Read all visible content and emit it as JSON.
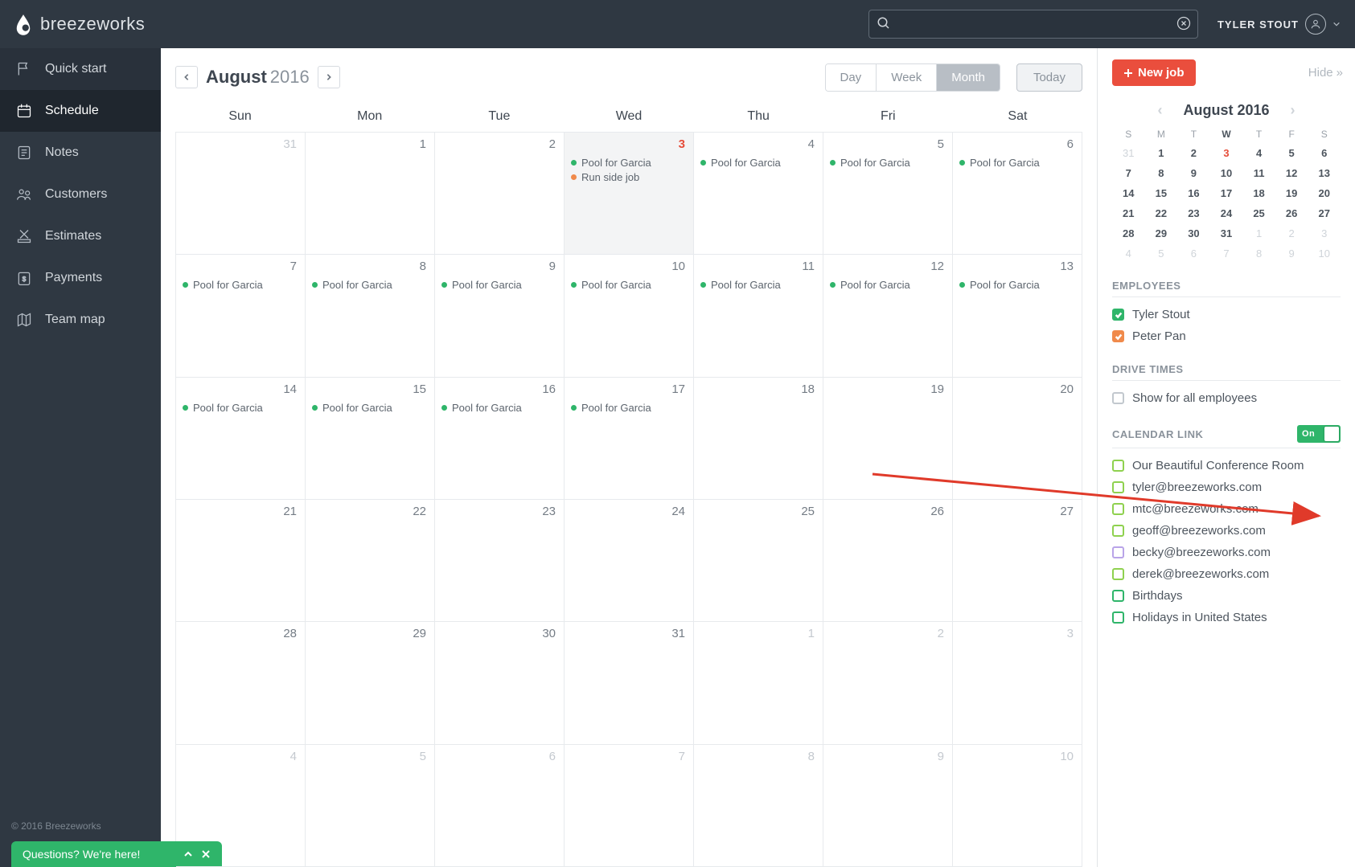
{
  "brand": "breezeworks",
  "user_name": "TYLER STOUT",
  "sidebar": {
    "items": [
      {
        "label": "Quick start",
        "icon": "flag-icon"
      },
      {
        "label": "Schedule",
        "icon": "calendar-icon"
      },
      {
        "label": "Notes",
        "icon": "notes-icon"
      },
      {
        "label": "Customers",
        "icon": "customers-icon"
      },
      {
        "label": "Estimates",
        "icon": "estimates-icon"
      },
      {
        "label": "Payments",
        "icon": "payments-icon"
      },
      {
        "label": "Team map",
        "icon": "map-icon"
      }
    ],
    "footer": "© 2016 Breezeworks",
    "help": "Questions? We're here!"
  },
  "calendar": {
    "month": "August",
    "year": "2016",
    "views": [
      "Day",
      "Week",
      "Month"
    ],
    "active_view": "Month",
    "today_label": "Today",
    "dow": [
      "Sun",
      "Mon",
      "Tue",
      "Wed",
      "Thu",
      "Fri",
      "Sat"
    ],
    "weeks": [
      [
        {
          "n": 31,
          "other": true
        },
        {
          "n": 1
        },
        {
          "n": 2
        },
        {
          "n": 3,
          "today": true,
          "events": [
            {
              "c": "#2fb56a",
              "t": "Pool for Garcia"
            },
            {
              "c": "#f08a4b",
              "t": "Run side job"
            }
          ]
        },
        {
          "n": 4,
          "events": [
            {
              "c": "#2fb56a",
              "t": "Pool for Garcia"
            }
          ]
        },
        {
          "n": 5,
          "events": [
            {
              "c": "#2fb56a",
              "t": "Pool for Garcia"
            }
          ]
        },
        {
          "n": 6,
          "events": [
            {
              "c": "#2fb56a",
              "t": "Pool for Garcia"
            }
          ]
        }
      ],
      [
        {
          "n": 7,
          "events": [
            {
              "c": "#2fb56a",
              "t": "Pool for Garcia"
            }
          ]
        },
        {
          "n": 8,
          "events": [
            {
              "c": "#2fb56a",
              "t": "Pool for Garcia"
            }
          ]
        },
        {
          "n": 9,
          "events": [
            {
              "c": "#2fb56a",
              "t": "Pool for Garcia"
            }
          ]
        },
        {
          "n": 10,
          "events": [
            {
              "c": "#2fb56a",
              "t": "Pool for Garcia"
            }
          ]
        },
        {
          "n": 11,
          "events": [
            {
              "c": "#2fb56a",
              "t": "Pool for Garcia"
            }
          ]
        },
        {
          "n": 12,
          "events": [
            {
              "c": "#2fb56a",
              "t": "Pool for Garcia"
            }
          ]
        },
        {
          "n": 13,
          "events": [
            {
              "c": "#2fb56a",
              "t": "Pool for Garcia"
            }
          ]
        }
      ],
      [
        {
          "n": 14,
          "events": [
            {
              "c": "#2fb56a",
              "t": "Pool for Garcia"
            }
          ]
        },
        {
          "n": 15,
          "events": [
            {
              "c": "#2fb56a",
              "t": "Pool for Garcia"
            }
          ]
        },
        {
          "n": 16,
          "events": [
            {
              "c": "#2fb56a",
              "t": "Pool for Garcia"
            }
          ]
        },
        {
          "n": 17,
          "events": [
            {
              "c": "#2fb56a",
              "t": "Pool for Garcia"
            }
          ]
        },
        {
          "n": 18
        },
        {
          "n": 19
        },
        {
          "n": 20
        }
      ],
      [
        {
          "n": 21
        },
        {
          "n": 22
        },
        {
          "n": 23
        },
        {
          "n": 24
        },
        {
          "n": 25
        },
        {
          "n": 26
        },
        {
          "n": 27
        }
      ],
      [
        {
          "n": 28
        },
        {
          "n": 29
        },
        {
          "n": 30
        },
        {
          "n": 31
        },
        {
          "n": 1,
          "other": true
        },
        {
          "n": 2,
          "other": true
        },
        {
          "n": 3,
          "other": true
        }
      ],
      [
        {
          "n": 4,
          "other": true
        },
        {
          "n": 5,
          "other": true
        },
        {
          "n": 6,
          "other": true
        },
        {
          "n": 7,
          "other": true
        },
        {
          "n": 8,
          "other": true
        },
        {
          "n": 9,
          "other": true
        },
        {
          "n": 10,
          "other": true
        }
      ]
    ]
  },
  "panel": {
    "new_job": "New job",
    "hide": "Hide",
    "mini": {
      "title": "August 2016",
      "dow": [
        "S",
        "M",
        "T",
        "W",
        "T",
        "F",
        "S"
      ],
      "weeks": [
        [
          {
            "n": 31,
            "o": true
          },
          {
            "n": 1,
            "b": true
          },
          {
            "n": 2,
            "b": true
          },
          {
            "n": 3,
            "t": true
          },
          {
            "n": 4,
            "b": true
          },
          {
            "n": 5,
            "b": true
          },
          {
            "n": 6,
            "b": true
          }
        ],
        [
          {
            "n": 7,
            "b": true
          },
          {
            "n": 8,
            "b": true
          },
          {
            "n": 9,
            "b": true
          },
          {
            "n": 10,
            "b": true
          },
          {
            "n": 11,
            "b": true
          },
          {
            "n": 12,
            "b": true
          },
          {
            "n": 13,
            "b": true
          }
        ],
        [
          {
            "n": 14,
            "b": true
          },
          {
            "n": 15,
            "b": true
          },
          {
            "n": 16,
            "b": true
          },
          {
            "n": 17,
            "b": true
          },
          {
            "n": 18,
            "b": true
          },
          {
            "n": 19,
            "b": true
          },
          {
            "n": 20,
            "b": true
          }
        ],
        [
          {
            "n": 21,
            "b": true
          },
          {
            "n": 22,
            "b": true
          },
          {
            "n": 23,
            "b": true
          },
          {
            "n": 24,
            "b": true
          },
          {
            "n": 25,
            "b": true
          },
          {
            "n": 26,
            "b": true
          },
          {
            "n": 27,
            "b": true
          }
        ],
        [
          {
            "n": 28,
            "b": true
          },
          {
            "n": 29,
            "b": true
          },
          {
            "n": 30,
            "b": true
          },
          {
            "n": 31,
            "b": true
          },
          {
            "n": 1,
            "o": true
          },
          {
            "n": 2,
            "o": true
          },
          {
            "n": 3,
            "o": true
          }
        ],
        [
          {
            "n": 4,
            "o": true
          },
          {
            "n": 5,
            "o": true
          },
          {
            "n": 6,
            "o": true
          },
          {
            "n": 7,
            "o": true
          },
          {
            "n": 8,
            "o": true
          },
          {
            "n": 9,
            "o": true
          },
          {
            "n": 10,
            "o": true
          }
        ]
      ]
    },
    "employees_h": "EMPLOYEES",
    "employees": [
      {
        "name": "Tyler Stout",
        "color": "#2fb56a",
        "checked": true
      },
      {
        "name": "Peter Pan",
        "color": "#f08a4b",
        "checked": true
      }
    ],
    "drive_h": "DRIVE TIMES",
    "drive_label": "Show for all employees",
    "callink_h": "CALENDAR LINK",
    "callink_on": "On",
    "links": [
      {
        "t": "Our Beautiful Conference Room",
        "c": "#8fd14f"
      },
      {
        "t": "tyler@breezeworks.com",
        "c": "#8fd14f"
      },
      {
        "t": "mtc@breezeworks.com",
        "c": "#8fd14f"
      },
      {
        "t": "geoff@breezeworks.com",
        "c": "#8fd14f"
      },
      {
        "t": "becky@breezeworks.com",
        "c": "#b9a4e8"
      },
      {
        "t": "derek@breezeworks.com",
        "c": "#8fd14f"
      },
      {
        "t": "Birthdays",
        "c": "#2fb56a"
      },
      {
        "t": "Holidays in United States",
        "c": "#2fb56a"
      }
    ]
  },
  "colors": {
    "accent": "#ea4e3d",
    "green": "#2fb56a"
  }
}
